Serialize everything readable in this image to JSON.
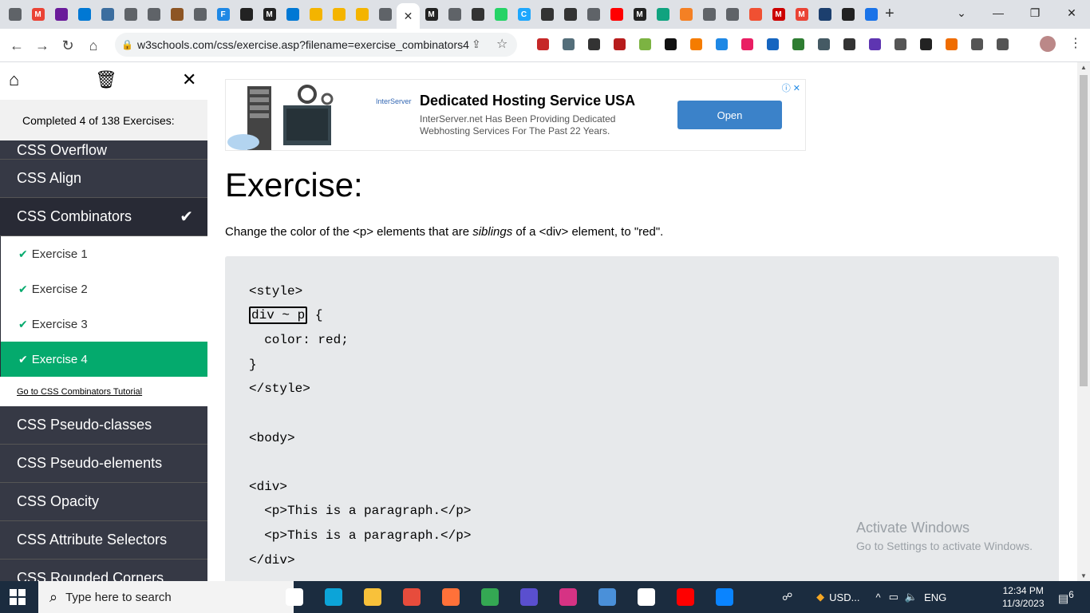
{
  "browser": {
    "url": "w3schools.com/css/exercise.asp?filename=exercise_combinators4",
    "tab_close": "✕",
    "new_tab": "+",
    "tab_favicons": [
      {
        "icon": "chrome-icon",
        "color": "#5f6368",
        "label": ""
      },
      {
        "icon": "gmail-icon",
        "color": "#ea4335",
        "label": "M"
      },
      {
        "icon": "mail-icon",
        "color": "#6a1b9a",
        "label": ""
      },
      {
        "icon": "windows-icon",
        "color": "#0078d4",
        "label": ""
      },
      {
        "icon": "shield-icon",
        "color": "#3c6e9f",
        "label": ""
      },
      {
        "icon": "chrome-icon",
        "color": "#5f6368",
        "label": ""
      },
      {
        "icon": "chrome-icon",
        "color": "#5f6368",
        "label": ""
      },
      {
        "icon": "avatar-icon",
        "color": "#8d5524",
        "label": ""
      },
      {
        "icon": "chrome-icon",
        "color": "#5f6368",
        "label": ""
      },
      {
        "icon": "f-icon",
        "color": "#1e88e5",
        "label": "F"
      },
      {
        "icon": "code-icon",
        "color": "#222",
        "label": ""
      },
      {
        "icon": "m-icon",
        "color": "#222",
        "label": "M"
      },
      {
        "icon": "vscode-icon",
        "color": "#0078d4",
        "label": ""
      },
      {
        "icon": "swirl-icon",
        "color": "#f4b400",
        "label": ""
      },
      {
        "icon": "swirl-icon",
        "color": "#f4b400",
        "label": ""
      },
      {
        "icon": "swirl-icon",
        "color": "#f4b400",
        "label": ""
      },
      {
        "icon": "chrome-icon",
        "color": "#5f6368",
        "label": ""
      }
    ],
    "tab_favicons_after": [
      {
        "icon": "m-icon",
        "color": "#222",
        "label": "M"
      },
      {
        "icon": "chrome-icon",
        "color": "#5f6368",
        "label": ""
      },
      {
        "icon": "news-icon",
        "color": "#333",
        "label": ""
      },
      {
        "icon": "whatsapp-icon",
        "color": "#25d366",
        "label": ""
      },
      {
        "icon": "c-icon",
        "color": "#1ea7fd",
        "label": "C"
      },
      {
        "icon": "car-icon",
        "color": "#333",
        "label": ""
      },
      {
        "icon": "car-icon",
        "color": "#333",
        "label": ""
      },
      {
        "icon": "chrome-icon",
        "color": "#5f6368",
        "label": ""
      },
      {
        "icon": "youtube-icon",
        "color": "#ff0000",
        "label": ""
      },
      {
        "icon": "m-icon",
        "color": "#222",
        "label": "M"
      },
      {
        "icon": "openai-icon",
        "color": "#10a37f",
        "label": ""
      },
      {
        "icon": "stack-icon",
        "color": "#f48024",
        "label": ""
      },
      {
        "icon": "chrome-icon",
        "color": "#5f6368",
        "label": ""
      },
      {
        "icon": "chrome-icon",
        "color": "#5f6368",
        "label": ""
      },
      {
        "icon": "git-icon",
        "color": "#f05032",
        "label": ""
      },
      {
        "icon": "m-icon",
        "color": "#c00",
        "label": "M"
      },
      {
        "icon": "gmail-icon",
        "color": "#ea4335",
        "label": "M"
      },
      {
        "icon": "upload-icon",
        "color": "#1c3f6e",
        "label": ""
      },
      {
        "icon": "github-icon",
        "color": "#222",
        "label": ""
      },
      {
        "icon": "download-icon",
        "color": "#1a73e8",
        "label": ""
      }
    ],
    "extension_colors": [
      "#c62828",
      "#546e7a",
      "#333",
      "#b71c1c",
      "#7cb342",
      "#111",
      "#f57c00",
      "#1e88e5",
      "#e91e63",
      "#1565c0",
      "#2e7d32",
      "#455a64",
      "#333",
      "#5e35b1",
      "#555",
      "#222",
      "#ef6c00",
      "#555",
      "#555"
    ]
  },
  "sidebar": {
    "completed_text": "Completed 4 of 138 Exercises:",
    "categories_top": [
      {
        "label": "CSS Overflow"
      },
      {
        "label": "CSS Align"
      }
    ],
    "active_category": {
      "label": "CSS Combinators",
      "check": "✔"
    },
    "exercises": [
      {
        "label": "Exercise 1",
        "check": "✔"
      },
      {
        "label": "Exercise 2",
        "check": "✔"
      },
      {
        "label": "Exercise 3",
        "check": "✔"
      },
      {
        "label": "Exercise 4",
        "check": "✔"
      }
    ],
    "tutorial_link": "Go to CSS Combinators Tutorial",
    "categories_bottom": [
      {
        "label": "CSS Pseudo-classes"
      },
      {
        "label": "CSS Pseudo-elements"
      },
      {
        "label": "CSS Opacity"
      },
      {
        "label": "CSS Attribute Selectors"
      },
      {
        "label": "CSS Rounded Corners"
      }
    ]
  },
  "ad": {
    "title": "Dedicated Hosting Service USA",
    "description": "InterServer.net Has Been Providing Dedicated Webhosting Services For The Past 22 Years.",
    "logo_text": "InterServer",
    "button": "Open"
  },
  "exercise": {
    "heading": "Exercise:",
    "instruction_before": "Change the color of the <p> elements that are ",
    "instruction_em": "siblings",
    "instruction_after": " of a <div> element, to \"red\".",
    "code": {
      "style_open": "<style>",
      "answer": "div ~ p",
      "brace_open": " {",
      "color_line": "  color: red;",
      "brace_close": "}",
      "style_close": "</style>",
      "body_open": "<body>",
      "div_open": "<div>",
      "p1": "  <p>This is a paragraph.</p>",
      "p2": "  <p>This is a paragraph.</p>",
      "div_close": "</div>"
    }
  },
  "watermark": {
    "line1": "Activate Windows",
    "line2": "Go to Settings to activate Windows."
  },
  "taskbar": {
    "search_placeholder": "Type here to search",
    "apps": [
      {
        "icon": "task-view-icon",
        "color": "#ffffff"
      },
      {
        "icon": "edge-icon",
        "color": "#0ca4d8"
      },
      {
        "icon": "file-explorer-icon",
        "color": "#f8c13a"
      },
      {
        "icon": "store-icon",
        "color": "#e74c3c"
      },
      {
        "icon": "firefox-icon",
        "color": "#ff7139"
      },
      {
        "icon": "chrome-icon",
        "color": "#34a853"
      },
      {
        "icon": "app-icon",
        "color": "#5a4fcf"
      },
      {
        "icon": "wps-icon",
        "color": "#d63384"
      },
      {
        "icon": "mail-icon",
        "color": "#4a90d9"
      },
      {
        "icon": "m-icon",
        "color": "#ffffff"
      },
      {
        "icon": "youtube-icon",
        "color": "#ff0000"
      },
      {
        "icon": "vscode-icon",
        "color": "#0a84ff"
      }
    ],
    "tray_currency": "USD...",
    "language": "ENG",
    "time": "12:34 PM",
    "date": "11/3/2023",
    "notifications": "6"
  }
}
